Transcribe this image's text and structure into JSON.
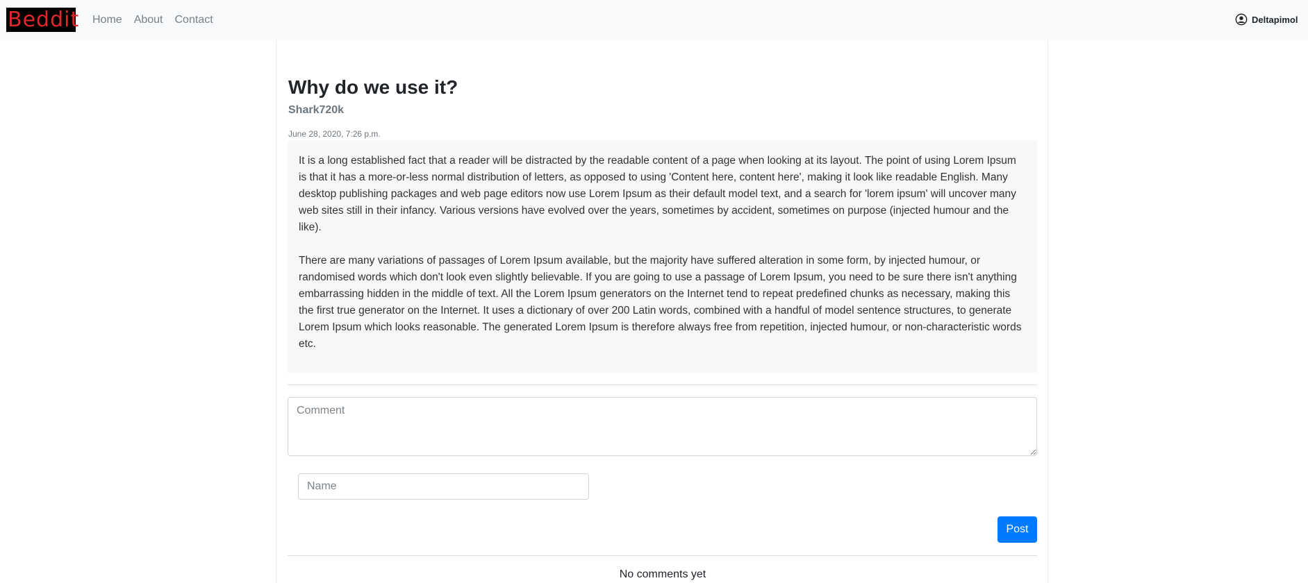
{
  "navbar": {
    "brand": "Beddit",
    "links": [
      "Home",
      "About",
      "Contact"
    ],
    "user": "Deltapimol"
  },
  "post": {
    "title": "Why do we use it?",
    "author": "Shark720k",
    "date": "June 28, 2020, 7:26 p.m.",
    "paragraphs": [
      "It is a long established fact that a reader will be distracted by the readable content of a page when looking at its layout. The point of using Lorem Ipsum is that it has a more-or-less normal distribution of letters, as opposed to using 'Content here, content here', making it look like readable English. Many desktop publishing packages and web page editors now use Lorem Ipsum as their default model text, and a search for 'lorem ipsum' will uncover many web sites still in their infancy. Various versions have evolved over the years, sometimes by accident, sometimes on purpose (injected humour and the like).",
      "There are many variations of passages of Lorem Ipsum available, but the majority have suffered alteration in some form, by injected humour, or randomised words which don't look even slightly believable. If you are going to use a passage of Lorem Ipsum, you need to be sure there isn't anything embarrassing hidden in the middle of text. All the Lorem Ipsum generators on the Internet tend to repeat predefined chunks as necessary, making this the first true generator on the Internet. It uses a dictionary of over 200 Latin words, combined with a handful of model sentence structures, to generate Lorem Ipsum which looks reasonable. The generated Lorem Ipsum is therefore always free from repetition, injected humour, or non-characteristic words etc."
    ]
  },
  "comment_form": {
    "comment_placeholder": "Comment",
    "comment_value": "",
    "name_placeholder": "Name",
    "name_value": "",
    "submit_label": "Post"
  },
  "comments": {
    "empty_text": "No comments yet"
  },
  "colors": {
    "brand_text": "#e0282b",
    "brand_bg": "#000000",
    "primary_button": "#007bff",
    "navbar_bg": "#f8f9fa"
  },
  "icons": {
    "user": "user-circle-icon",
    "dropdown": "caret-down-icon"
  }
}
